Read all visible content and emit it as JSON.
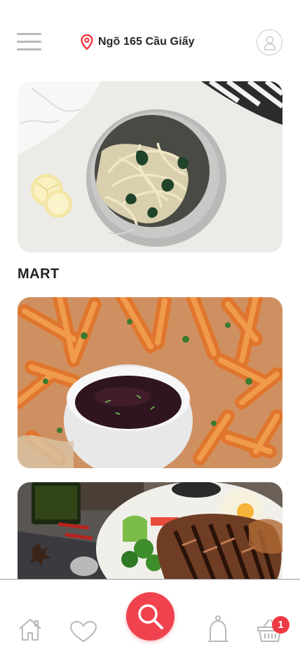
{
  "header": {
    "location": "Ngõ 165 Cầu Giấy",
    "menu_icon": "hamburger-menu-icon",
    "location_icon": "map-pin-icon",
    "profile_icon": "user-profile-icon"
  },
  "sections": {
    "mart_title": "MART"
  },
  "cards": [
    {
      "image": "pasta-with-spinach-bowl"
    },
    {
      "image": "sweet-potato-fries-with-dip"
    },
    {
      "image": "grilled-steak-plate"
    }
  ],
  "bottom_nav": {
    "items": [
      "home-icon",
      "heart-icon",
      "search-icon",
      "bell-icon",
      "basket-icon"
    ],
    "cart_badge": "1"
  },
  "colors": {
    "accent": "#f0434f",
    "badge": "#ee3a44",
    "icon_gray": "#b9b9b9",
    "text": "#262626"
  }
}
